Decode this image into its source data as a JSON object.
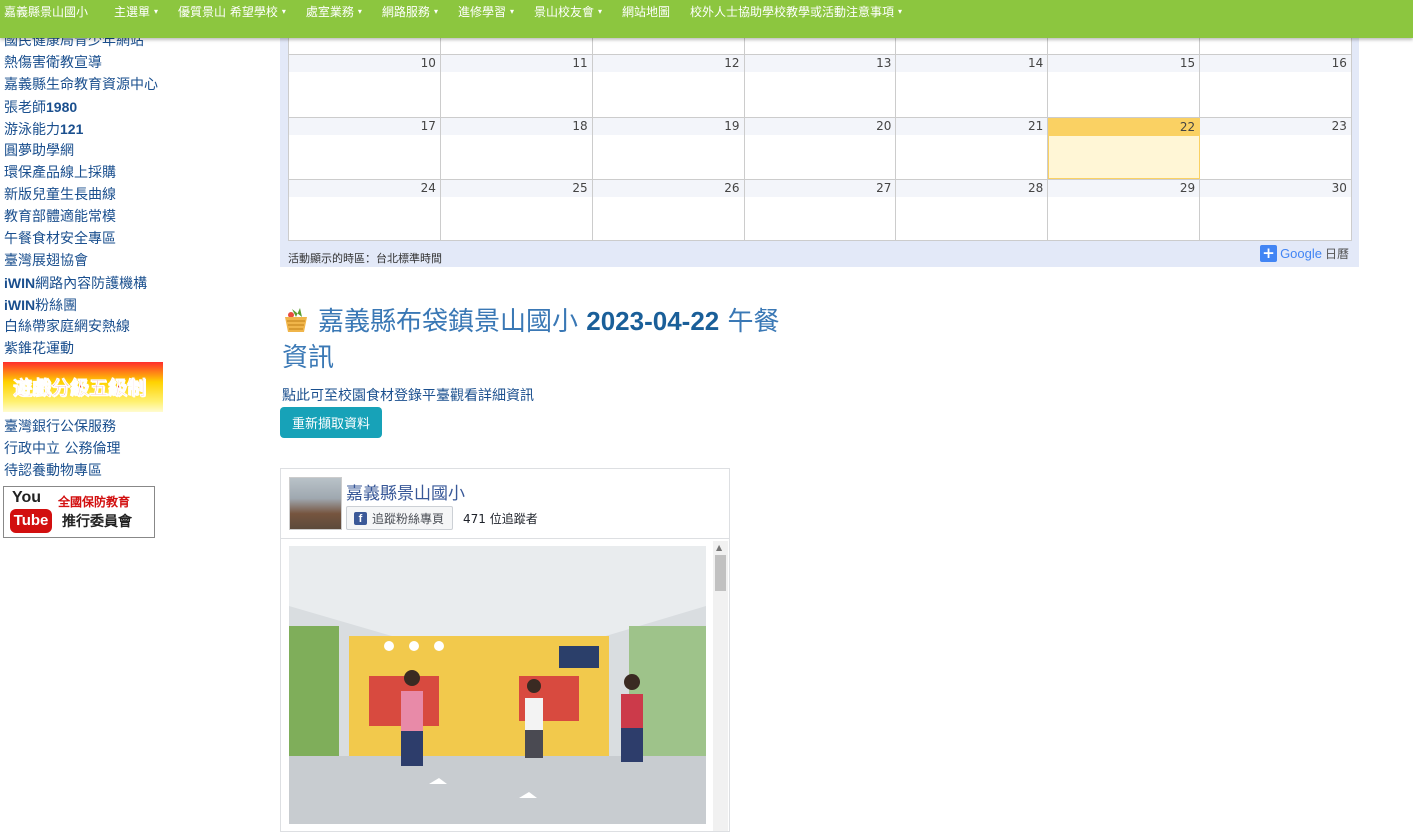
{
  "nav": {
    "brand": "嘉義縣景山國小",
    "items": [
      {
        "label": "主選單",
        "dropdown": true
      },
      {
        "label": "優質景山 希望學校",
        "dropdown": true
      },
      {
        "label": "處室業務",
        "dropdown": true
      },
      {
        "label": "網路服務",
        "dropdown": true
      },
      {
        "label": "進修學習",
        "dropdown": true
      },
      {
        "label": "景山校友會",
        "dropdown": true
      },
      {
        "label": "網站地圖",
        "dropdown": false
      },
      {
        "label": "校外人士協助學校教學或活動注意事項",
        "dropdown": true
      }
    ],
    "bg_color": "#8cc63f"
  },
  "sidebar": {
    "links": [
      {
        "text": "國民健康局青少年網站"
      },
      {
        "text": "熱傷害衛教宣導"
      },
      {
        "text": "嘉義縣生命教育資源中心"
      },
      {
        "text": "張老師",
        "bold": "1980"
      },
      {
        "text": "游泳能力",
        "bold": "121"
      },
      {
        "text": "圓夢助學網"
      },
      {
        "text": "環保產品線上採購"
      },
      {
        "text": "新版兒童生長曲線"
      },
      {
        "text": "教育部體適能常模"
      },
      {
        "text": "午餐食材安全專區"
      },
      {
        "text": "臺灣展翅協會"
      },
      {
        "prefix": "iWIN",
        "text": "網路內容防護機構"
      },
      {
        "prefix": "iWIN",
        "text": "粉絲團"
      },
      {
        "text": "白絲帶家庭網安熱線"
      },
      {
        "text": "紫錐花運動"
      }
    ],
    "game_banner": "遊戲分級五級制",
    "links2": [
      {
        "text": "臺灣銀行公保服務"
      },
      {
        "text": "行政中立 公務倫理"
      },
      {
        "text": "待認養動物專區"
      }
    ],
    "yt_banner": {
      "you": "You",
      "tube": "Tube",
      "line1": "全國保防教育",
      "line2": "推行委員會"
    }
  },
  "calendar": {
    "weeks": [
      [
        "",
        "",
        "",
        "",
        "",
        "",
        ""
      ],
      [
        "10",
        "11",
        "12",
        "13",
        "14",
        "15",
        "16"
      ],
      [
        "17",
        "18",
        "19",
        "20",
        "21",
        "22",
        "23"
      ],
      [
        "24",
        "25",
        "26",
        "27",
        "28",
        "29",
        "30"
      ]
    ],
    "today": "22",
    "footer": "活動顯示的時區：台北標準時間",
    "google": "Google",
    "cal_label": "日曆",
    "accent": "#fad163"
  },
  "lunch": {
    "title_a": "嘉義縣布袋鎮景山國小 ",
    "title_date": "2023-04-22",
    "title_b": " 午餐 資訊",
    "link": "點此可至校園食材登錄平臺觀看詳細資訊",
    "button": "重新擷取資料"
  },
  "facebook": {
    "page_name": "嘉義縣景山國小",
    "follow_label": "追蹤粉絲專頁",
    "followers": "471 位追蹤者"
  }
}
